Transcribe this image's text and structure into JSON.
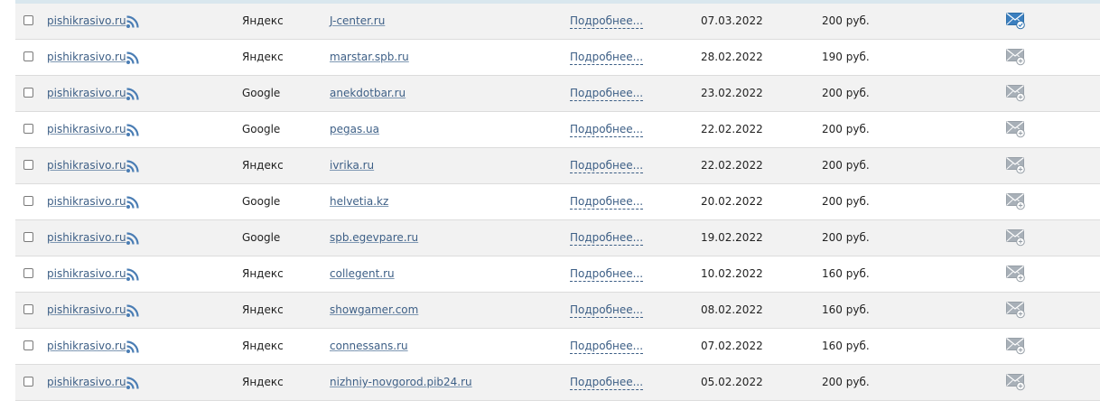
{
  "colors": {
    "link": "#3d5f86",
    "rss": "#4a7db4",
    "row_alt": "#f2f2f2",
    "mail": "#a8b0b8",
    "mail_active": "#3b7fbf"
  },
  "rows": [
    {
      "site": "pishikrasivo.ru",
      "engine": "Яндекс",
      "donor": "J-center.ru",
      "more": "Подробнее...",
      "date": "07.03.2022",
      "price": "200 руб.",
      "mail_icon": "envelope-check-icon"
    },
    {
      "site": "pishikrasivo.ru",
      "engine": "Яндекс",
      "donor": "marstar.spb.ru",
      "more": "Подробнее...",
      "date": "28.02.2022",
      "price": "190 руб.",
      "mail_icon": "envelope-plus-icon"
    },
    {
      "site": "pishikrasivo.ru",
      "engine": "Google",
      "donor": "anekdotbar.ru",
      "more": "Подробнее...",
      "date": "23.02.2022",
      "price": "200 руб.",
      "mail_icon": "envelope-plus-icon"
    },
    {
      "site": "pishikrasivo.ru",
      "engine": "Google",
      "donor": "pegas.ua",
      "more": "Подробнее...",
      "date": "22.02.2022",
      "price": "200 руб.",
      "mail_icon": "envelope-plus-icon"
    },
    {
      "site": "pishikrasivo.ru",
      "engine": "Яндекс",
      "donor": "ivrika.ru",
      "more": "Подробнее...",
      "date": "22.02.2022",
      "price": "200 руб.",
      "mail_icon": "envelope-plus-icon"
    },
    {
      "site": "pishikrasivo.ru",
      "engine": "Google",
      "donor": "helvetia.kz",
      "more": "Подробнее...",
      "date": "20.02.2022",
      "price": "200 руб.",
      "mail_icon": "envelope-plus-icon"
    },
    {
      "site": "pishikrasivo.ru",
      "engine": "Google",
      "donor": "spb.egevpare.ru",
      "more": "Подробнее...",
      "date": "19.02.2022",
      "price": "200 руб.",
      "mail_icon": "envelope-plus-icon"
    },
    {
      "site": "pishikrasivo.ru",
      "engine": "Яндекс",
      "donor": "collegent.ru",
      "more": "Подробнее...",
      "date": "10.02.2022",
      "price": "160 руб.",
      "mail_icon": "envelope-plus-icon"
    },
    {
      "site": "pishikrasivo.ru",
      "engine": "Яндекс",
      "donor": "showgamer.com",
      "more": "Подробнее...",
      "date": "08.02.2022",
      "price": "160 руб.",
      "mail_icon": "envelope-plus-icon"
    },
    {
      "site": "pishikrasivo.ru",
      "engine": "Яндекс",
      "donor": "connessans.ru",
      "more": "Подробнее...",
      "date": "07.02.2022",
      "price": "160 руб.",
      "mail_icon": "envelope-plus-icon"
    },
    {
      "site": "pishikrasivo.ru",
      "engine": "Яндекс",
      "donor": "nizhniy-novgorod.pib24.ru",
      "more": "Подробнее...",
      "date": "05.02.2022",
      "price": "200 руб.",
      "mail_icon": "envelope-plus-icon"
    }
  ]
}
